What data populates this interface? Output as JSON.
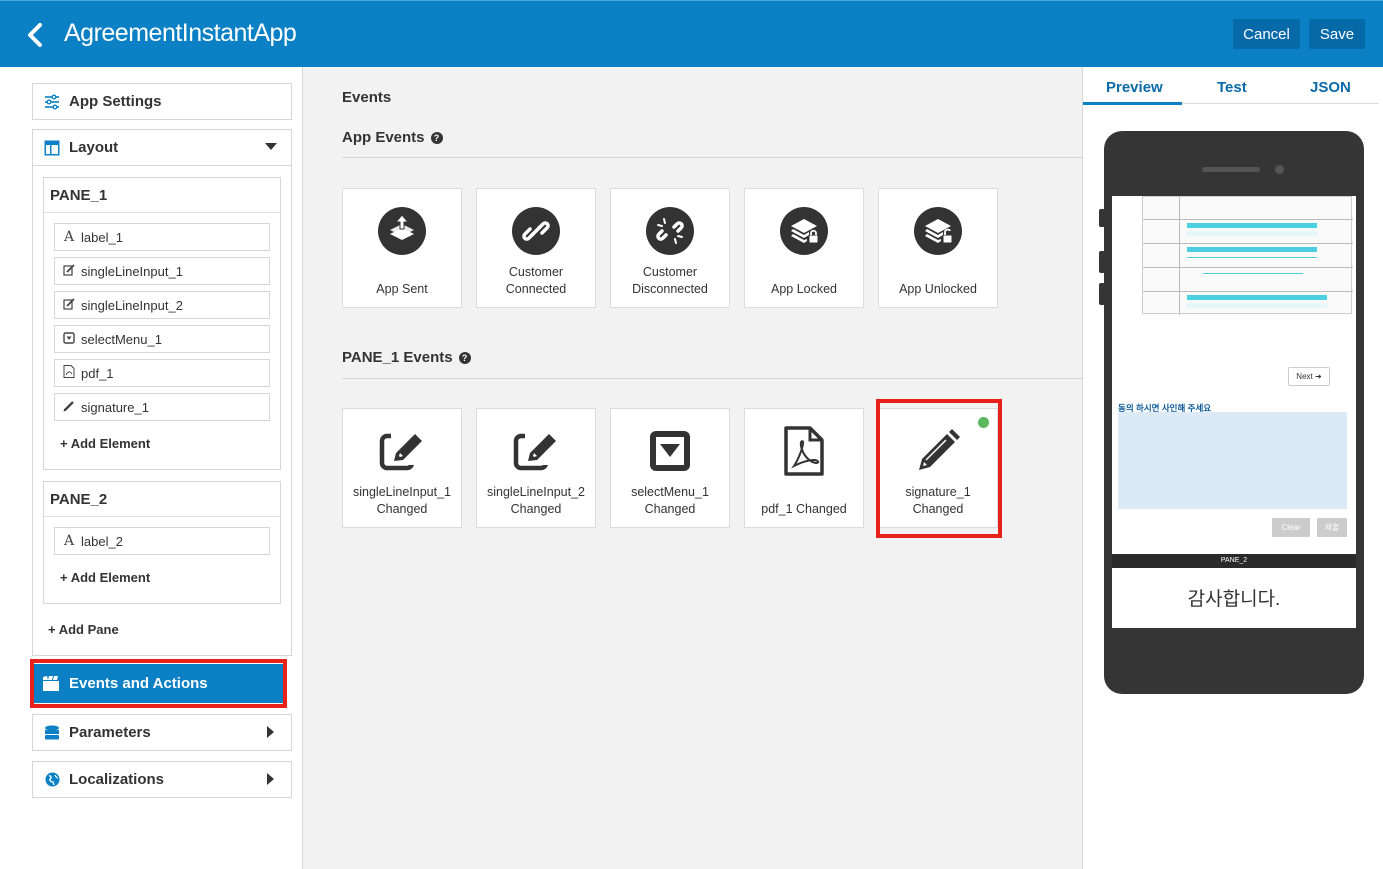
{
  "header": {
    "title": "AgreementInstantApp",
    "cancel_label": "Cancel",
    "save_label": "Save"
  },
  "sidebar": {
    "app_settings": "App Settings",
    "layout": "Layout",
    "panes": [
      {
        "title": "PANE_1",
        "elements": [
          {
            "label": "label_1",
            "icon": "text-icon"
          },
          {
            "label": "singleLineInput_1",
            "icon": "edit-icon"
          },
          {
            "label": "singleLineInput_2",
            "icon": "edit-icon"
          },
          {
            "label": "selectMenu_1",
            "icon": "select-icon"
          },
          {
            "label": "pdf_1",
            "icon": "pdf-icon"
          },
          {
            "label": "signature_1",
            "icon": "pencil-icon"
          }
        ],
        "add_element": "+ Add Element"
      },
      {
        "title": "PANE_2",
        "elements": [
          {
            "label": "label_2",
            "icon": "text-icon"
          }
        ],
        "add_element": "+ Add Element"
      }
    ],
    "add_pane": "+ Add Pane",
    "events_and_actions": "Events and Actions",
    "parameters": "Parameters",
    "localizations": "Localizations",
    "accent": "#0b80c5",
    "highlight": "#e8221b"
  },
  "main": {
    "title": "Events",
    "app_events_title": "App Events",
    "app_events": [
      {
        "label": "App Sent",
        "icon": "app-sent-icon"
      },
      {
        "label": "Customer Connected",
        "icon": "link-icon"
      },
      {
        "label": "Customer Disconnected",
        "icon": "unlink-icon"
      },
      {
        "label": "App Locked",
        "icon": "layers-lock-icon"
      },
      {
        "label": "App Unlocked",
        "icon": "layers-unlock-icon"
      }
    ],
    "pane_events_title": "PANE_1 Events",
    "pane_events": [
      {
        "label": "singleLineInput_1 Changed",
        "icon": "edit-icon"
      },
      {
        "label": "singleLineInput_2 Changed",
        "icon": "edit-icon"
      },
      {
        "label": "selectMenu_1 Changed",
        "icon": "select-icon"
      },
      {
        "label": "pdf_1 Changed",
        "icon": "pdf-icon"
      },
      {
        "label": "signature_1 Changed",
        "icon": "pencil-icon",
        "active": true
      }
    ]
  },
  "preview": {
    "tabs": [
      "Preview",
      "Test",
      "JSON"
    ],
    "active_tab": "Preview",
    "next_label": "Next",
    "signature_prompt": "동의 하시면 사인해 주세요",
    "clear_label": "Clear",
    "submit_label": "제출",
    "pane2_label": "PANE_2",
    "thanks_text": "감사합니다."
  }
}
